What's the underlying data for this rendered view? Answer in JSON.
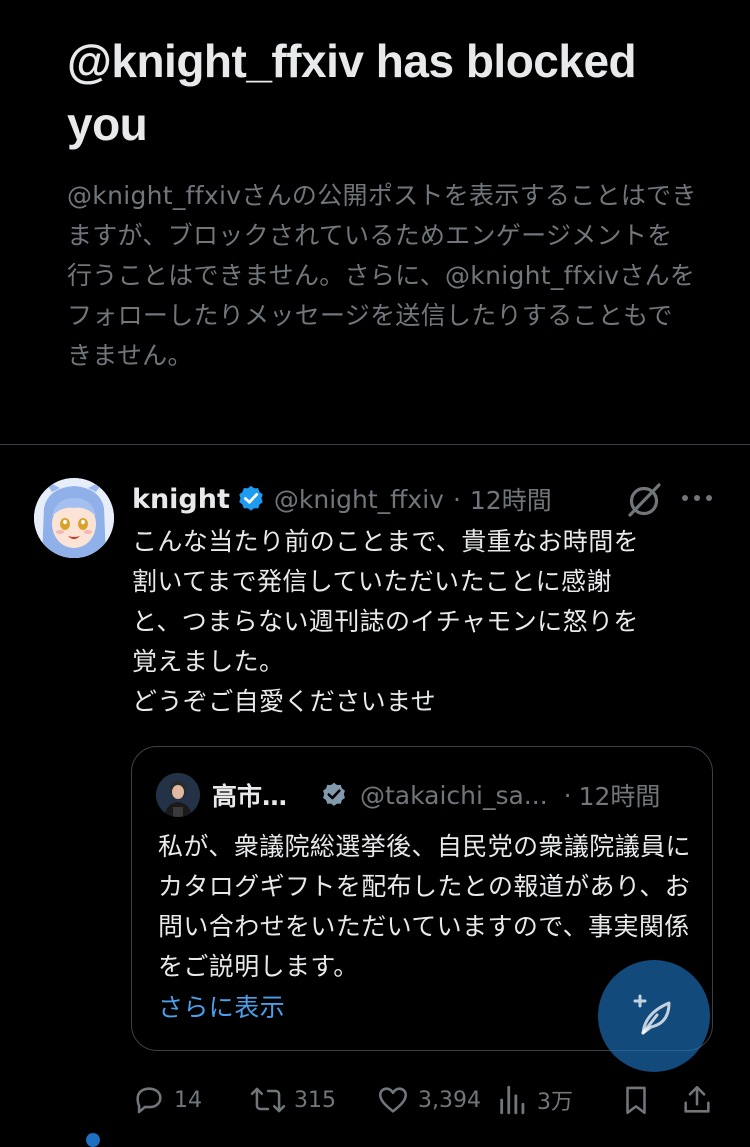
{
  "blocked": {
    "title": "@knight_ffxiv has blocked you",
    "description": "@knight_ffxivさんの公開ポストを表示することはできますが、ブロックされているためエンゲージメントを行うことはできません。さらに、@knight_ffxivさんをフォローしたりメッセージを送信したりすることもできません。"
  },
  "tweet": {
    "display_name": "knight",
    "handle": "@knight_ffxiv",
    "separator": "·",
    "time": "12時間",
    "text": "こんな当たり前のことまで、貴重なお時間を\n割いてまで発信していただいたことに感謝\nと、つまらない週刊誌のイチャモンに怒りを\n覚えました。\nどうぞご自愛くださいませ",
    "quote": {
      "display_name": "高市…",
      "handle": "@takaichi_sa...",
      "separator": "·",
      "time": "12時間",
      "text": "私が、衆議院総選挙後、自民党の衆議院議員にカタログギフトを配布したとの報道があり、お問い合わせをいただいていますので、事実関係をご説明します。",
      "show_more": "さらに表示"
    },
    "actions": {
      "replies": "14",
      "reposts": "315",
      "likes": "3,394",
      "views": "3万"
    }
  },
  "colors": {
    "background": "#000000",
    "primary_text": "#e7e9ea",
    "secondary_text": "#71767b",
    "link": "#4c9fea",
    "verified": "#1d9bf0",
    "fab": "#1d78c8"
  },
  "icons": {
    "verified": "verified-badge-icon",
    "grok": "grok-icon",
    "more": "more-icon",
    "reply": "reply-icon",
    "repost": "repost-icon",
    "like": "heart-icon",
    "views": "views-icon",
    "bookmark": "bookmark-icon",
    "share": "share-icon",
    "compose": "compose-icon"
  }
}
